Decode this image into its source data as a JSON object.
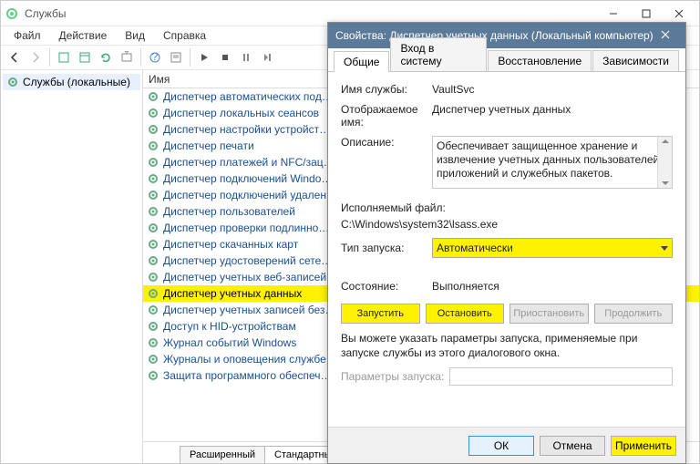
{
  "window": {
    "title": "Службы",
    "menu": [
      "Файл",
      "Действие",
      "Вид",
      "Справка"
    ]
  },
  "leftPane": {
    "item": "Службы (локальные)"
  },
  "list": {
    "header": "Имя",
    "items": [
      "Диспетчер автоматических под…",
      "Диспетчер локальных сеансов",
      "Диспетчер настройки устройст…",
      "Диспетчер печати",
      "Диспетчер платежей и NFC/зац…",
      "Диспетчер подключений Windo…",
      "Диспетчер подключений удален…",
      "Диспетчер пользователей",
      "Диспетчер проверки подлинно…",
      "Диспетчер скачанных карт",
      "Диспетчер удостоверений сете…",
      "Диспетчер учетных веб-записей",
      "Диспетчер учетных данных",
      "Диспетчер учетных записей без…",
      "Доступ к HID-устройствам",
      "Журнал событий Windows",
      "Журналы и оповещения службе…",
      "Защита программного обеспеч…"
    ],
    "selectedIndex": 12,
    "bottomTabs": {
      "extended": "Расширенный",
      "standard": "Стандартный"
    }
  },
  "dialog": {
    "title": "Свойства: Диспетчер учетных данных (Локальный компьютер)",
    "tabs": [
      "Общие",
      "Вход в систему",
      "Восстановление",
      "Зависимости"
    ],
    "activeTab": 0,
    "labels": {
      "serviceName": "Имя службы:",
      "displayName": "Отображаемое имя:",
      "description": "Описание:",
      "exe": "Исполняемый файл:",
      "startup": "Тип запуска:",
      "state": "Состояние:",
      "params": "Параметры запуска:"
    },
    "values": {
      "serviceName": "VaultSvc",
      "displayName": "Диспетчер учетных данных",
      "description": "Обеспечивает защищенное хранение и извлечение учетных данных пользователей, приложений и служебных пакетов.",
      "exe": "C:\\Windows\\system32\\lsass.exe",
      "startup": "Автоматически",
      "state": "Выполняется",
      "params": ""
    },
    "hint": "Вы можете указать параметры запуска, применяемые при запуске службы из этого диалогового окна.",
    "buttons": {
      "start": "Запустить",
      "stop": "Остановить",
      "pause": "Приостановить",
      "resume": "Продолжить",
      "ok": "ОК",
      "cancel": "Отмена",
      "apply": "Применить"
    }
  }
}
